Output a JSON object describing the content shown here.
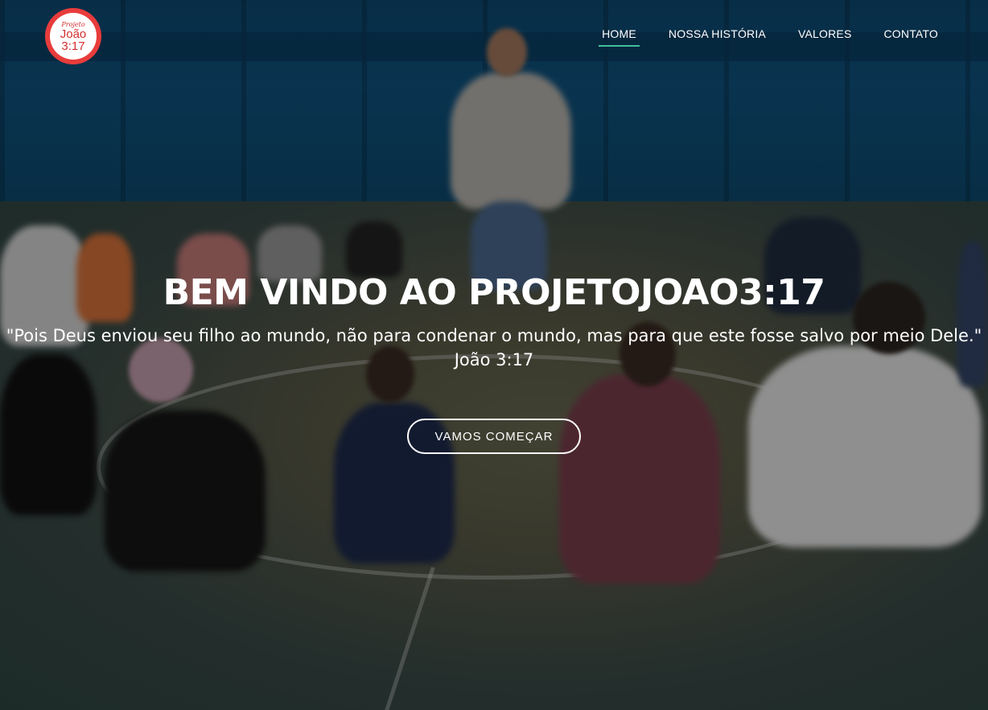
{
  "logo": {
    "small": "Projeto",
    "line1": "João",
    "line2": "3:17"
  },
  "nav": {
    "items": [
      {
        "label": "HOME",
        "active": true
      },
      {
        "label": "NOSSA HISTÓRIA"
      },
      {
        "label": "VALORES"
      },
      {
        "label": "CONTATO"
      }
    ]
  },
  "hero": {
    "title": "BEM VINDO AO PROJETOJOAO3:17",
    "quote": "\"Pois Deus enviou seu filho ao mundo, não para condenar o mundo, mas para que este fosse salvo por meio Dele.\" João 3:17",
    "cta": "VAMOS COMEÇAR"
  },
  "colors": {
    "accent": "#3fbf9a",
    "logo_red": "#e83c3c"
  }
}
